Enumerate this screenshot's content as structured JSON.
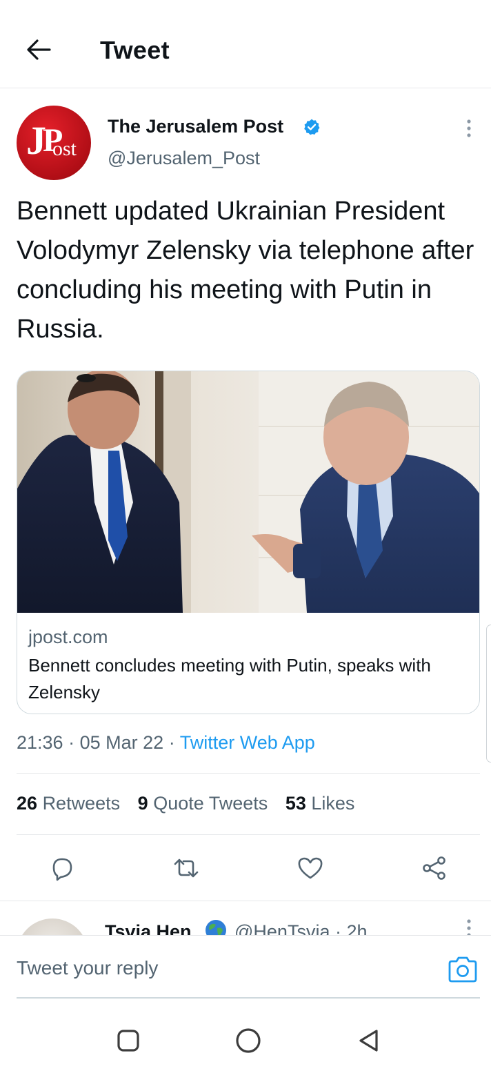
{
  "header": {
    "title": "Tweet",
    "back_icon": "arrow-left-icon"
  },
  "author": {
    "name": "The Jerusalem Post",
    "handle": "@Jerusalem_Post",
    "verified": true,
    "avatar_logo_text": "JPost",
    "avatar_color": "#d0121b"
  },
  "tweet": {
    "text": "Bennett updated Ukrainian President Volodymyr Zelensky via telephone after concluding his meeting with Putin in Russia.",
    "time": "21:36",
    "separator": "·",
    "date": "05 Mar 22",
    "source": "Twitter Web App"
  },
  "card": {
    "domain": "jpost.com",
    "title": "Bennett concludes meeting with Putin, speaks with Zelensky",
    "image_icon": "news-photo-two-men-talking"
  },
  "stats": {
    "retweets_count": "26",
    "retweets_label": "Retweets",
    "quotes_count": "9",
    "quotes_label": "Quote Tweets",
    "likes_count": "53",
    "likes_label": "Likes"
  },
  "actions": [
    "reply-icon",
    "retweet-icon",
    "like-icon",
    "share-icon"
  ],
  "reply_preview": {
    "name": "Tsvia Hen",
    "handle_time": "@HenTsvia · 2h",
    "badge_icon": "globe-emoji-icon"
  },
  "reply_bar": {
    "placeholder": "Tweet your reply",
    "camera_icon": "camera-icon"
  },
  "system_nav": [
    "recents-square-icon",
    "home-circle-icon",
    "back-triangle-icon"
  ],
  "colors": {
    "accent": "#1d9bf0",
    "text": "#0f1419",
    "secondary": "#536471",
    "border": "#cfd9de"
  }
}
